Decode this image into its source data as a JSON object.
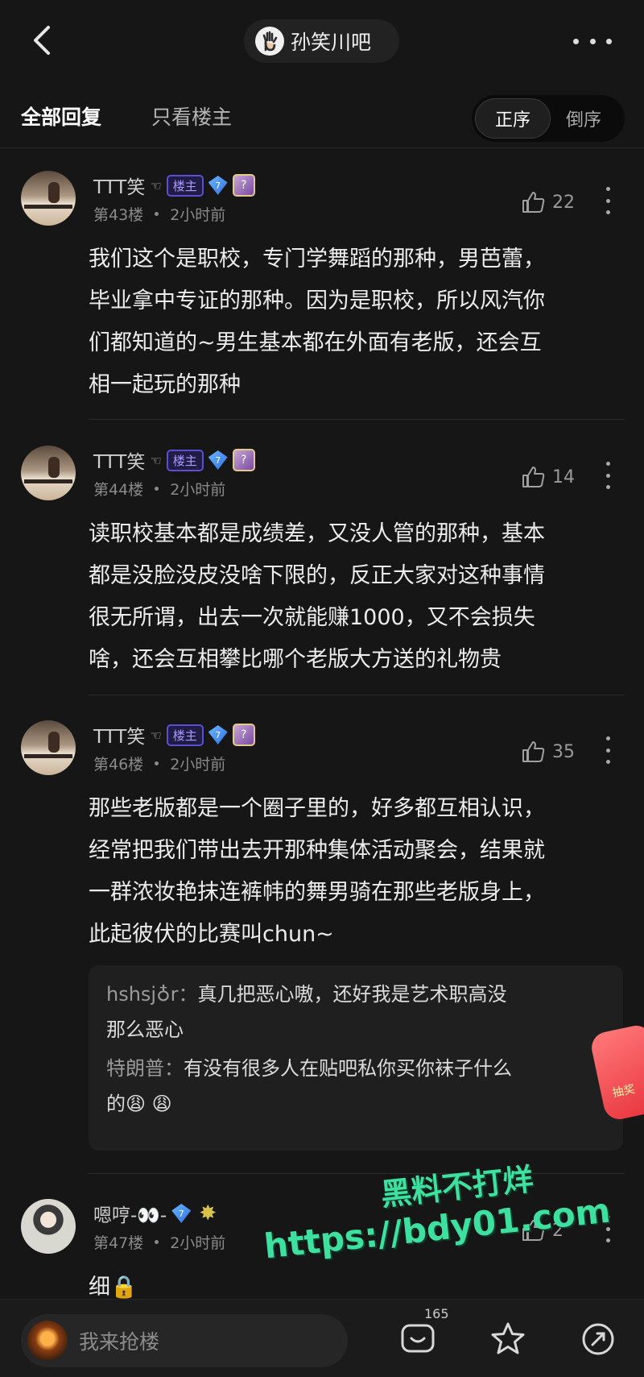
{
  "header": {
    "forum_name": "孙笑川吧"
  },
  "tabs": {
    "all_replies": "全部回复",
    "only_host": "只看楼主",
    "order_asc": "正序",
    "order_desc": "倒序"
  },
  "posts": [
    {
      "username": "TTT笑",
      "host_badge": "楼主",
      "level": "7",
      "floor": "第43楼",
      "time": "2小时前",
      "likes": "22",
      "lines": [
        "我们这个是职校，专门学舞蹈的那种，男芭蕾，",
        "毕业拿中专证的那种。因为是职校，所以风汽你",
        "们都知道的~男生基本都在外面有老版，还会互",
        "相一起玩的那种"
      ]
    },
    {
      "username": "TTT笑",
      "host_badge": "楼主",
      "level": "7",
      "floor": "第44楼",
      "time": "2小时前",
      "likes": "14",
      "lines": [
        "读职校基本都是成绩差，又没人管的那种，基本",
        "都是没脸没皮没啥下限的，反正大家对这种事情",
        "很无所谓，出去一次就能赚1000，又不会损失",
        "啥，还会互相攀比哪个老版大方送的礼物贵"
      ]
    },
    {
      "username": "TTT笑",
      "host_badge": "楼主",
      "level": "7",
      "floor": "第46楼",
      "time": "2小时前",
      "likes": "35",
      "lines": [
        "那些老版都是一个圈子里的，好多都互相认识，",
        "经常把我们带出去开那种集体活动聚会，结果就",
        "一群浓妆艳抹连裤帏的舞男骑在那些老版身上，",
        "此起彼伏的比赛叫chun~"
      ]
    },
    {
      "username": "嗯哼-👀-",
      "level": "7",
      "floor": "第47楼",
      "time": "2小时前",
      "likes": "2",
      "lines": [
        "细🔒"
      ]
    }
  ],
  "subreplies": [
    {
      "user": "hshsj♁r：",
      "lines": [
        "真几把恶心嗷，还好我是艺术职高没",
        "那么恶心"
      ]
    },
    {
      "user": "特朗普：",
      "lines": [
        "有没有很多人在贴吧私你买你袜子什么",
        "的😩 😩"
      ]
    }
  ],
  "float_ad": {
    "label": "抽奖"
  },
  "watermark": {
    "line1": "黑料不打烊",
    "line2": "https://bdy01.com"
  },
  "bottom": {
    "placeholder": "我来抢楼",
    "comment_count": "165"
  },
  "colors": {
    "background": "#161616",
    "host_badge": "#5a4fd1",
    "watermark": "#3ee0a0"
  }
}
